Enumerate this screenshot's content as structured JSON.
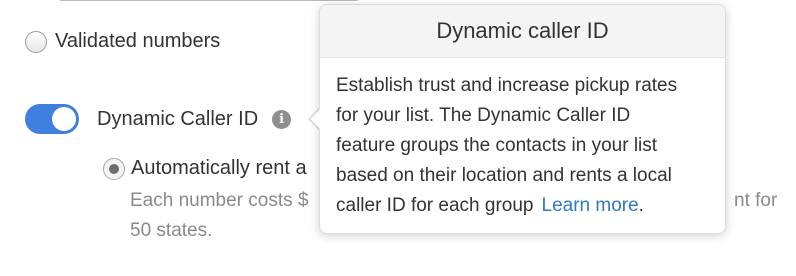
{
  "options": {
    "validated_numbers_label": "Validated numbers",
    "dynamic_caller_id_label": "Dynamic Caller ID",
    "dynamic_caller_id_enabled": true,
    "auto_rent_label": "Automatically rent a",
    "auto_rent_help_line1": "Each number costs $",
    "auto_rent_help_line1_end": "nt for",
    "auto_rent_help_line2": "50 states."
  },
  "popover": {
    "title": "Dynamic caller ID",
    "body_lines": [
      "Establish trust and increase pickup rates",
      "for your list. The Dynamic Caller ID",
      "feature groups the contacts in your list",
      "based on their location and rents a local",
      "caller ID for each group"
    ],
    "link_text": "Learn more",
    "link_suffix": "."
  },
  "colors": {
    "toggle_on": "#3e7fe0",
    "link": "#2f7ac0"
  },
  "icons": {
    "info": "info-icon"
  }
}
